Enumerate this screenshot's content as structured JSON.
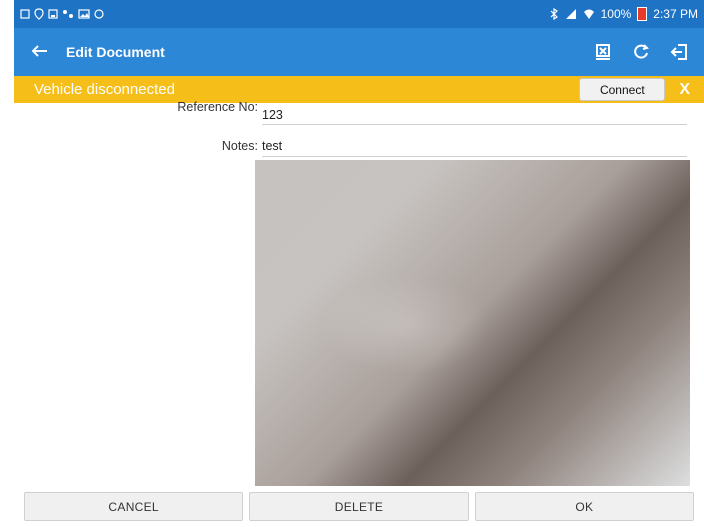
{
  "status_bar": {
    "battery_text": "100%",
    "time": "2:37 PM"
  },
  "app_bar": {
    "back_icon": "arrow-left-icon",
    "title": "Edit Document"
  },
  "banner": {
    "text": "Vehicle disconnected",
    "connect_label": "Connect",
    "dismiss_label": "X"
  },
  "form": {
    "reference_label": "Reference No:",
    "reference_value": "123",
    "notes_label": "Notes:",
    "notes_value": "test"
  },
  "bottom_buttons": {
    "cancel": "CANCEL",
    "delete": "DELETE",
    "ok": "OK"
  },
  "colors": {
    "status_bar": "#1e73c4",
    "app_bar": "#2d87d7",
    "banner": "#f6be19"
  }
}
